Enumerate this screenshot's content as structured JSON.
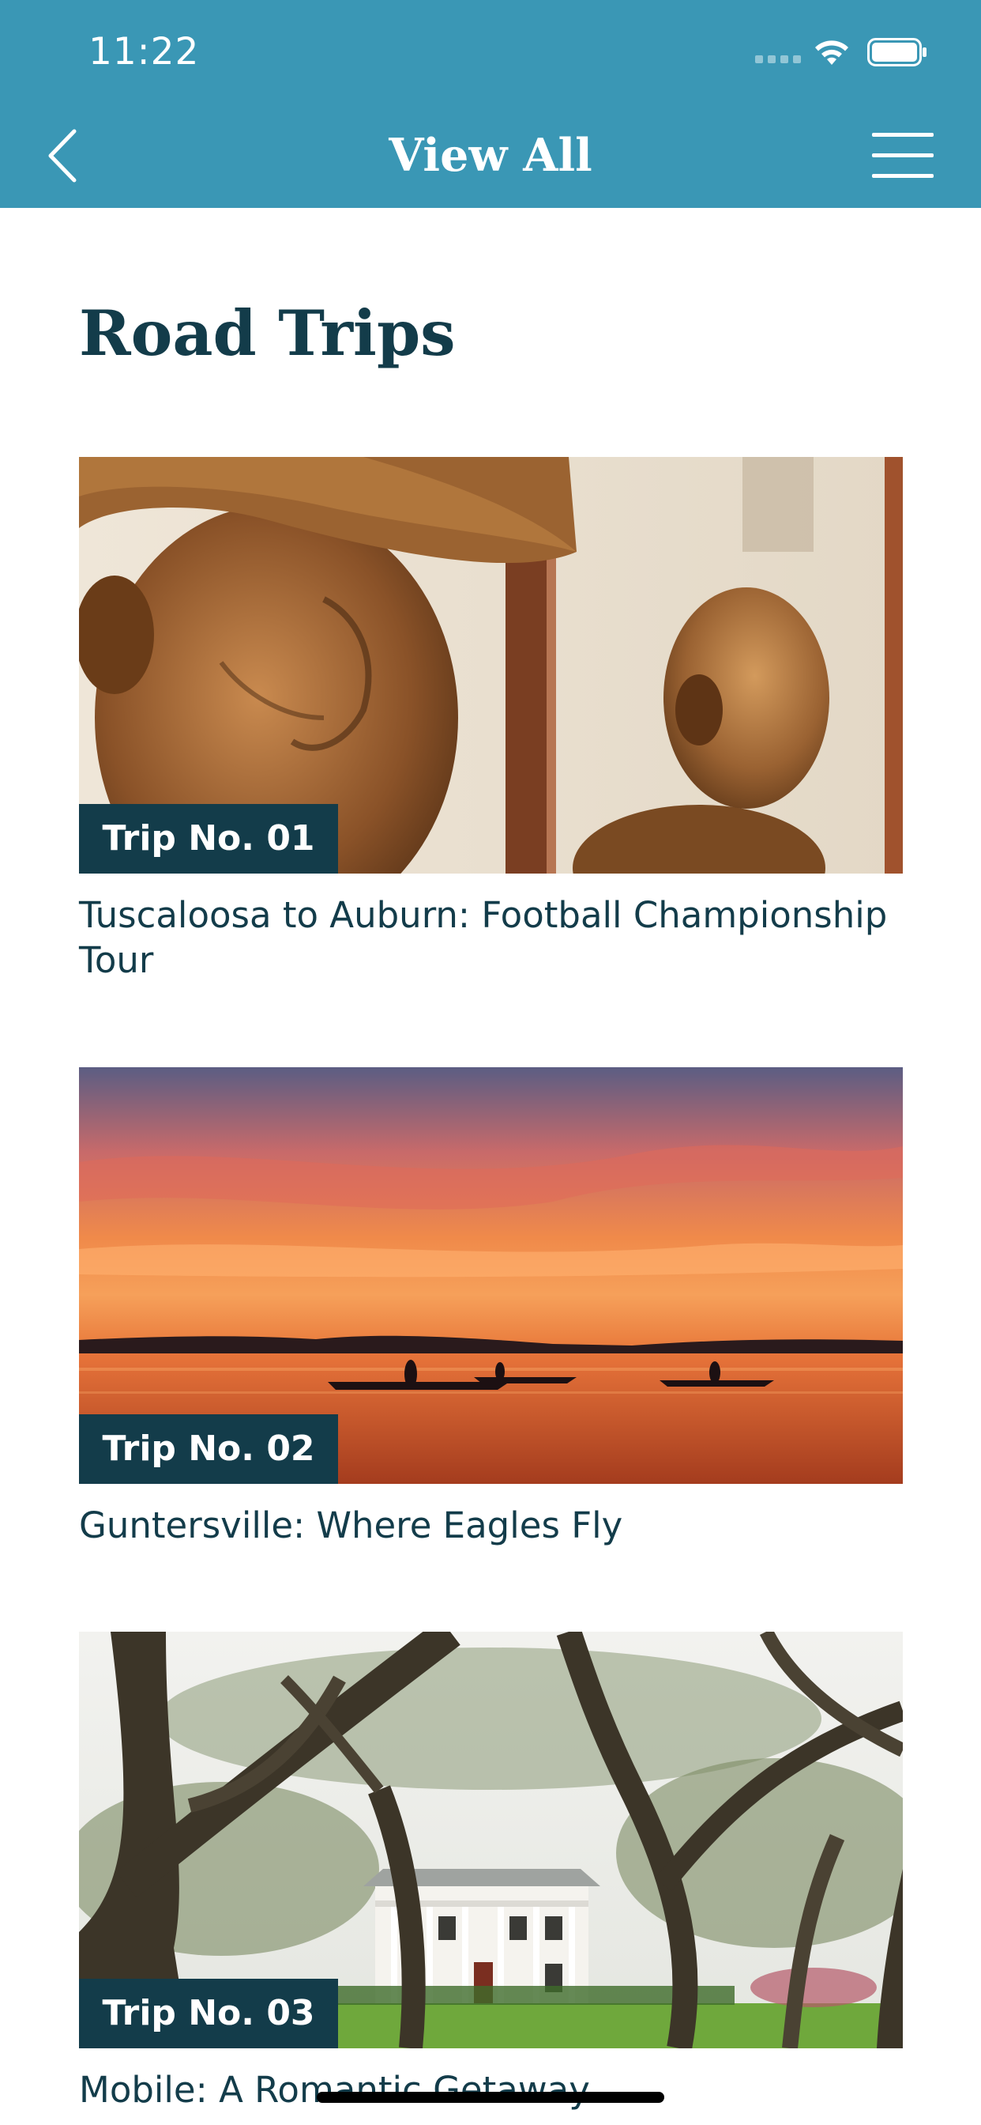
{
  "status_bar": {
    "time": "11:22"
  },
  "header": {
    "title": "View All",
    "back_icon": "chevron-left-icon",
    "menu_icon": "hamburger-menu-icon",
    "background_color": "#3a97b5"
  },
  "page": {
    "title": "Road Trips"
  },
  "trips": [
    {
      "badge": "Trip No. 01",
      "title": "Tuscaloosa to Auburn: Football Championship Tour",
      "image": "bronze-statue-busts-photo"
    },
    {
      "badge": "Trip No. 02",
      "title": "Guntersville: Where Eagles Fly",
      "image": "sunset-lake-kayaks-photo"
    },
    {
      "badge": "Trip No. 03",
      "title": "Mobile: A Romantic Getaway",
      "image": "oak-trees-mansion-photo"
    }
  ],
  "colors": {
    "text_dark": "#133c4a",
    "badge_bg": "#133c4a"
  }
}
